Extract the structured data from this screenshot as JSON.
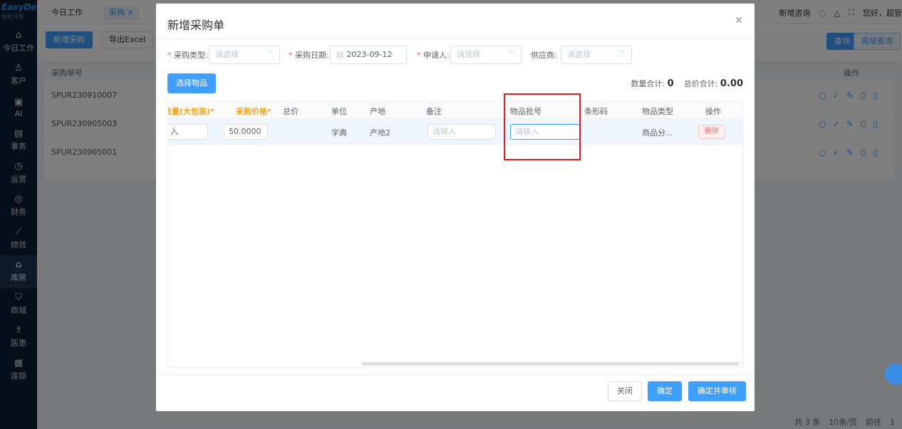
{
  "sidebar": {
    "logo": "EasyDent",
    "logo_sub": "轻松牙医",
    "items": [
      {
        "label": "今日工作",
        "icon": "⌂"
      },
      {
        "label": "客户",
        "icon": "♙"
      },
      {
        "label": "AI",
        "icon": "▣"
      },
      {
        "label": "事务",
        "icon": "▤"
      },
      {
        "label": "运营",
        "icon": "◷"
      },
      {
        "label": "财务",
        "icon": "◎"
      },
      {
        "label": "绩效",
        "icon": "⟋"
      },
      {
        "label": "库房",
        "icon": "⌂"
      },
      {
        "label": "商城",
        "icon": "⛉"
      },
      {
        "label": "医患",
        "icon": "♗"
      },
      {
        "label": "连锁",
        "icon": "▦"
      }
    ]
  },
  "topbar": {
    "tabs": [
      {
        "label": "今日工作"
      },
      {
        "label": "采购 ×"
      }
    ],
    "consult": "新增咨询",
    "greeting": "您好，超管"
  },
  "toolbar": {
    "add_label": "新增采购",
    "export_label": "导出Excel",
    "query_label": "查询",
    "advanced_label": "高级查询"
  },
  "bg_table": {
    "col_order": "采购单号",
    "col_action": "操作",
    "rows": [
      {
        "id": "SPUR230910007"
      },
      {
        "id": "SPUR230905003"
      },
      {
        "id": "SPUR230905001"
      }
    ]
  },
  "bg_pager": {
    "total": "共 3 条",
    "size": "10条/页",
    "goto": "前往",
    "page": "1"
  },
  "modal": {
    "title": "新增采购单",
    "form": {
      "type_label": "采购类型:",
      "type_placeholder": "请选择",
      "date_label": "采购日期:",
      "date_value": "2023-09-12",
      "applicant_label": "申请人:",
      "applicant_placeholder": "请选择",
      "supplier_label": "供应商:",
      "supplier_placeholder": "请选择"
    },
    "select_items_label": "选择物品",
    "totals": {
      "qty_label": "数量合计:",
      "qty": "0",
      "price_label": "总价合计:",
      "price": "0.00"
    },
    "table": {
      "headers": [
        "数量(大包装)*",
        "采购价格*",
        "总价",
        "单位",
        "产地",
        "备注",
        "物品批号",
        "条形码",
        "物品类型",
        "操作"
      ],
      "row": {
        "qty_value": "入",
        "price": "50.0000",
        "unit": "字典",
        "origin": "产地2",
        "note_placeholder": "请输入",
        "batch_placeholder": "请输入",
        "item_type": "商品分...",
        "delete_label": "删除"
      }
    },
    "footer": {
      "close_label": "关闭",
      "confirm_label": "确定",
      "confirm_audit_label": "确定并审核"
    }
  }
}
